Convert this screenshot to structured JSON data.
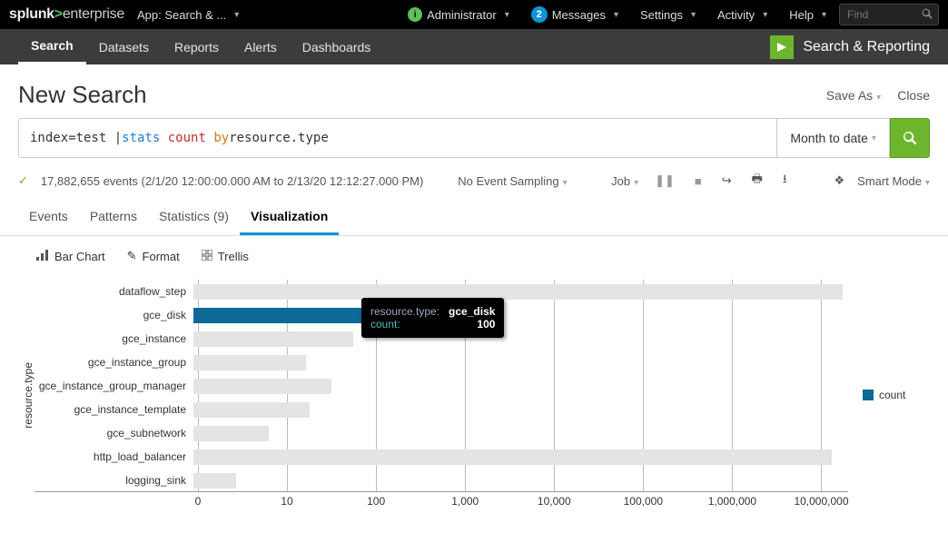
{
  "topbar": {
    "logo_pre": "splunk",
    "logo_post": "enterprise",
    "app_label": "App: Search & ...",
    "admin": "Administrator",
    "messages": "Messages",
    "messages_count": "2",
    "settings": "Settings",
    "activity": "Activity",
    "help": "Help",
    "find_placeholder": "Find"
  },
  "nav": {
    "items": [
      "Search",
      "Datasets",
      "Reports",
      "Alerts",
      "Dashboards"
    ],
    "active": 0,
    "app_name": "Search & Reporting"
  },
  "page": {
    "title": "New Search",
    "save_as": "Save As",
    "close": "Close"
  },
  "search": {
    "q_pre": "index=test | ",
    "q_stats": "stats",
    "q_count": "count",
    "q_by": "by",
    "q_post": " resource.type",
    "time_range": "Month to date"
  },
  "status": {
    "events_text": "17,882,655 events (2/1/20 12:00:00.000 AM to 2/13/20 12:12:27.000 PM)",
    "sampling": "No Event Sampling",
    "job": "Job",
    "smart": "Smart Mode"
  },
  "result_tabs": {
    "events": "Events",
    "patterns": "Patterns",
    "stats": "Statistics (9)",
    "viz": "Visualization"
  },
  "viz_tb": {
    "bar": "Bar Chart",
    "format": "Format",
    "trellis": "Trellis"
  },
  "chart_data": {
    "type": "bar",
    "orientation": "horizontal",
    "xscale": "log",
    "ylabel": "resource.type",
    "xticks": [
      "0",
      "10",
      "100",
      "1,000",
      "10,000",
      "100,000",
      "1,000,000",
      "10,000,000"
    ],
    "categories": [
      "dataflow_step",
      "gce_disk",
      "gce_instance",
      "gce_instance_group",
      "gce_instance_group_manager",
      "gce_instance_template",
      "gce_subnetwork",
      "http_load_balancer",
      "logging_sink"
    ],
    "values": [
      17500000,
      100,
      60,
      18,
      35,
      20,
      7,
      13000000,
      3
    ],
    "highlight_index": 1,
    "legend": "count",
    "tooltip": {
      "k1": "resource.type:",
      "v1": "gce_disk",
      "k2": "count:",
      "v2": "100"
    }
  }
}
